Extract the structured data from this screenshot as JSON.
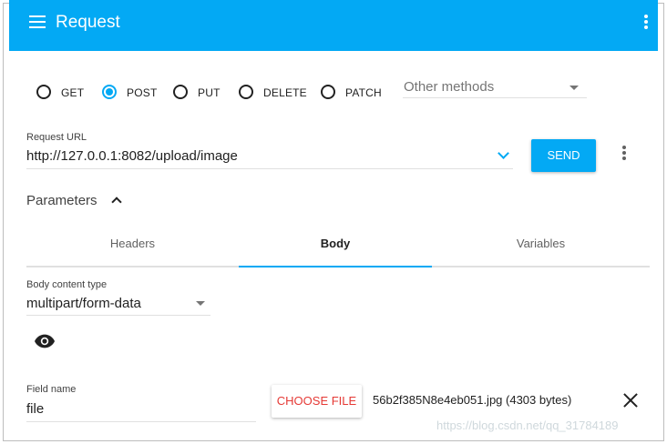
{
  "appbar": {
    "title": "Request",
    "color": "#03a9f4",
    "menu_icon": "hamburger-menu-icon",
    "more_icon": "more-vert-icon"
  },
  "methods": {
    "options": [
      {
        "label": "GET",
        "checked": false
      },
      {
        "label": "POST",
        "checked": true
      },
      {
        "label": "PUT",
        "checked": false
      },
      {
        "label": "DELETE",
        "checked": false
      },
      {
        "label": "PATCH",
        "checked": false
      }
    ],
    "other_placeholder": "Other methods"
  },
  "url": {
    "label": "Request URL",
    "value": "http://127.0.0.1:8082/upload/image"
  },
  "send_label": "SEND",
  "parameters": {
    "label": "Parameters",
    "expanded": true
  },
  "tabs": [
    {
      "label": "Headers",
      "active": false
    },
    {
      "label": "Body",
      "active": true
    },
    {
      "label": "Variables",
      "active": false
    }
  ],
  "body": {
    "content_type_label": "Body content type",
    "content_type_value": "multipart/form-data"
  },
  "field": {
    "name_label": "Field name",
    "name_value": "file",
    "choose_label": "CHOOSE FILE",
    "file_info": "56b2f385N8e4eb051.jpg (4303 bytes)"
  },
  "watermark": "https://blog.csdn.net/qq_31784189"
}
